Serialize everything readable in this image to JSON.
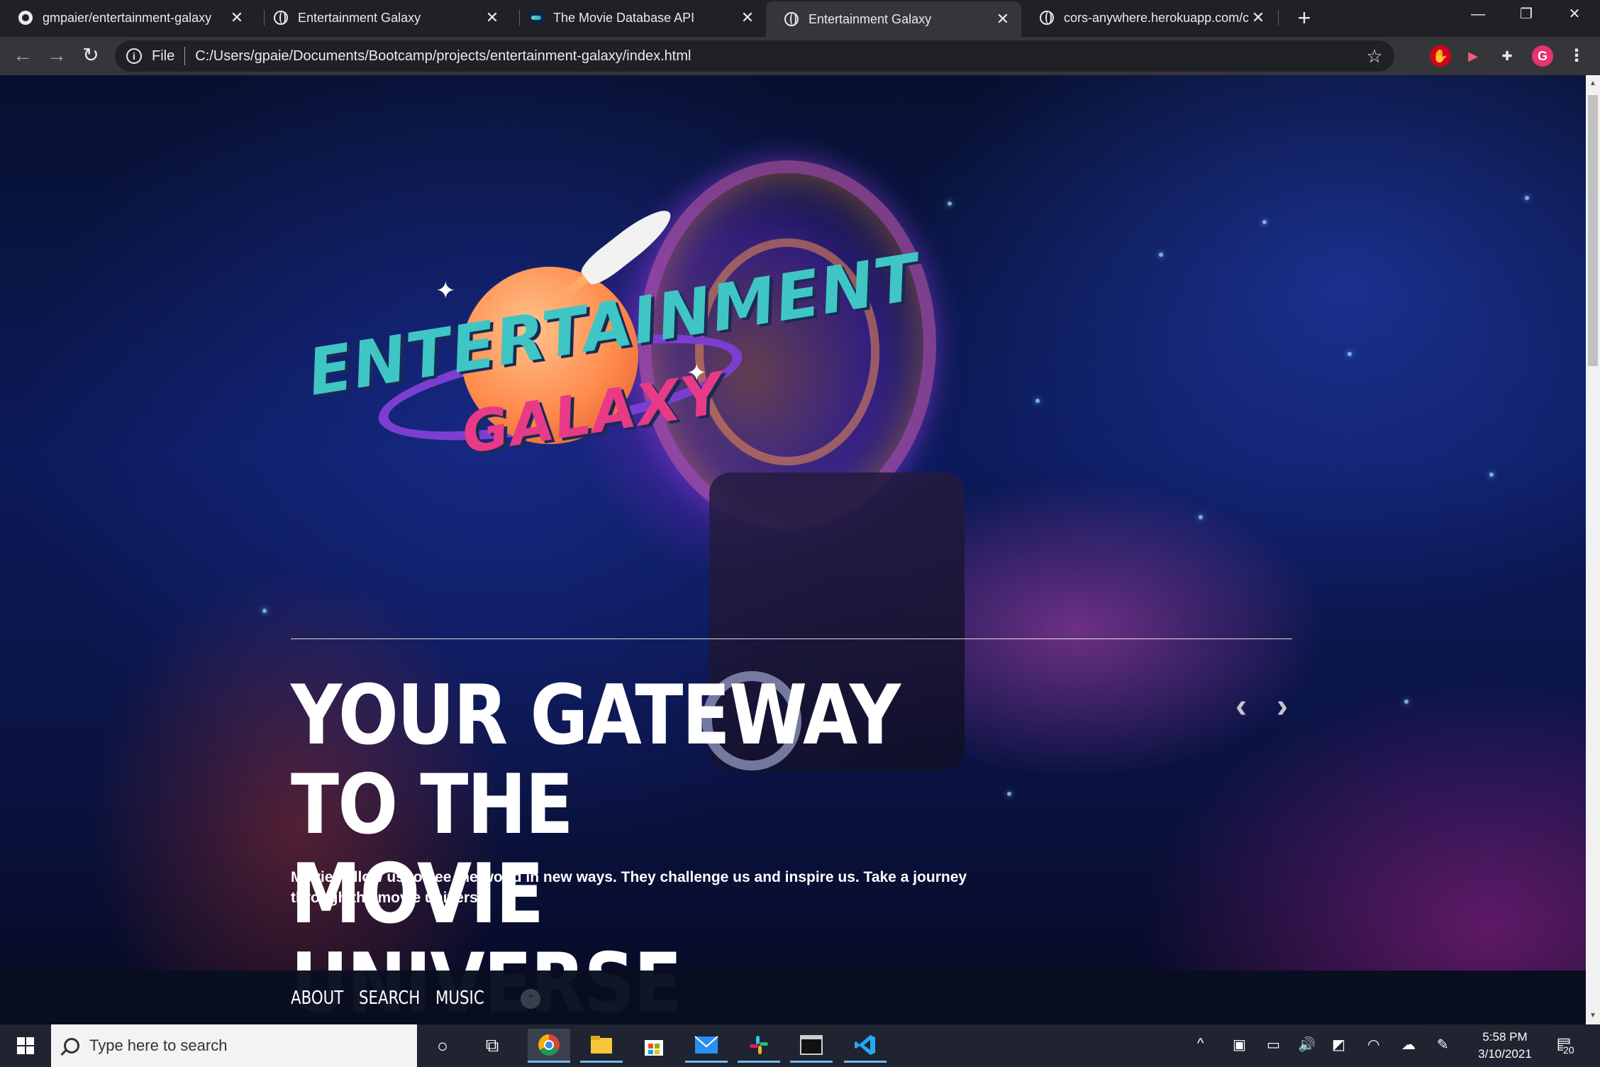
{
  "browser": {
    "tabs": [
      {
        "title": "gmpaier/entertainment-galaxy",
        "icon": "github-icon"
      },
      {
        "title": "Entertainment Galaxy",
        "icon": "globe-icon"
      },
      {
        "title": "The Movie Database API",
        "icon": "tmdb-icon"
      },
      {
        "title": "Entertainment Galaxy",
        "icon": "globe-icon",
        "active": true
      },
      {
        "title": "cors-anywhere.herokuapp.com/c",
        "icon": "globe-icon"
      }
    ],
    "close_glyph": "✕",
    "new_tab_glyph": "+",
    "window_controls": {
      "minimize": "—",
      "restore": "❐",
      "close": "✕"
    },
    "nav": {
      "back": "←",
      "forward": "→",
      "reload": "↻"
    },
    "omnibox": {
      "info": "i",
      "scheme_label": "File",
      "url": "C:/Users/gpaie/Documents/Bootcamp/projects/entertainment-galaxy/index.html",
      "bookmark": "☆"
    },
    "extensions": {
      "ext1": "✋",
      "ext2": "▶",
      "puzzle": "✚",
      "profile": "G",
      "menu": "⋮"
    }
  },
  "page": {
    "logo": {
      "line1": "ENTERTAINMENT",
      "line2": "GALAXY"
    },
    "headline_line1": "YOUR GATEWAY TO THE",
    "headline_line2": "MOVIE UNIVERSE",
    "subtext": "Movies allow us to see the world in new ways. They challenge us and inspire us. Take a journey through the movie universe.",
    "carousel": {
      "prev": "‹",
      "next": "›"
    },
    "navbar": {
      "about": "ABOUT",
      "search": "SEARCH",
      "music": "MUSIC",
      "toggle": "⌃"
    }
  },
  "taskbar": {
    "search_placeholder": "Type here to search",
    "cortana": "○",
    "task_view": "⧉",
    "clock_time": "5:58 PM",
    "clock_date": "3/10/2021",
    "notification_count": "20",
    "tray": {
      "chevron": "^",
      "volume": "🔊",
      "wifi": "◠"
    }
  },
  "colors": {
    "accent_teal": "#3fc6c4",
    "accent_pink": "#e83a86",
    "planet_orange": "#ff8a4c",
    "navbar_bg": "#080e20"
  }
}
